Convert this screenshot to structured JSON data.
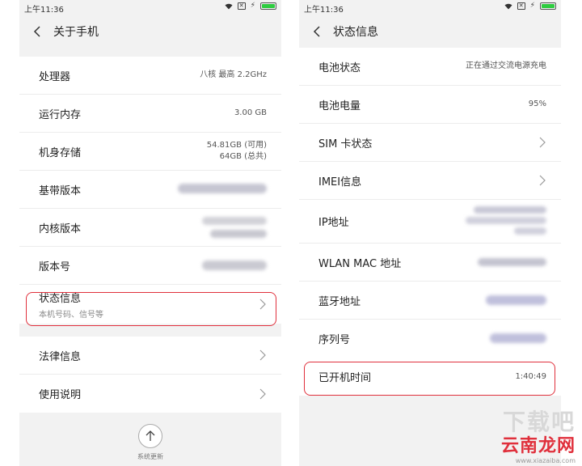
{
  "left": {
    "status_time": "上午11:36",
    "title": "关于手机",
    "rows": [
      {
        "label": "处理器",
        "value": "八核 最高 2.2GHz"
      },
      {
        "label": "运行内存",
        "value": "3.00 GB"
      },
      {
        "label": "机身存储",
        "value_line1": "54.81GB (可用)",
        "value_line2": "64GB (总共)"
      },
      {
        "label": "基带版本"
      },
      {
        "label": "内核版本"
      },
      {
        "label": "版本号"
      }
    ],
    "status_info": {
      "label": "状态信息",
      "sub": "本机号码、信号等"
    },
    "legal": "法律信息",
    "manual": "使用说明",
    "update_label": "系统更新"
  },
  "right": {
    "status_time": "上午11:36",
    "title": "状态信息",
    "rows": [
      {
        "label": "电池状态",
        "value": "正在通过交流电源充电"
      },
      {
        "label": "电池电量",
        "value": "95%"
      },
      {
        "label": "SIM 卡状态"
      },
      {
        "label": "IMEI信息"
      },
      {
        "label": "IP地址"
      },
      {
        "label": "WLAN MAC 地址"
      },
      {
        "label": "蓝牙地址"
      },
      {
        "label": "序列号"
      }
    ],
    "uptime": {
      "label": "已开机时间",
      "value": "1:40:49"
    }
  },
  "watermark": {
    "brand_top": "下载吧",
    "brand": "云南龙网",
    "site": "www.xiazaiba.com"
  },
  "colors": {
    "highlight": "#e0303c",
    "battery": "#2ecc40"
  }
}
